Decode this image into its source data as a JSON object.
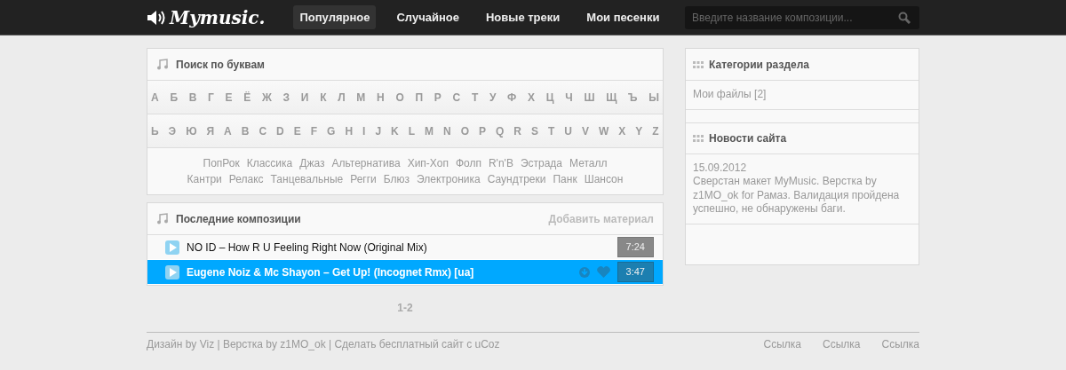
{
  "header": {
    "logo": "Mymusic.",
    "nav": [
      {
        "label": "Популярное",
        "selected": true
      },
      {
        "label": "Случайное",
        "selected": false
      },
      {
        "label": "Новые треки",
        "selected": false
      },
      {
        "label": "Мои песенки",
        "selected": false
      }
    ],
    "search": {
      "placeholder": "Введите название композиции..."
    }
  },
  "letter_search": {
    "title": "Поиск по буквам",
    "letter_rows": [
      [
        "А",
        "Б",
        "В",
        "Г",
        "Е",
        "Ё",
        "Ж",
        "З",
        "И",
        "К",
        "Л",
        "М",
        "Н",
        "О",
        "П",
        "Р",
        "С",
        "Т",
        "У",
        "Ф",
        "Х",
        "Ц",
        "Ч",
        "Ш",
        "Щ",
        "Ъ",
        "Ы"
      ],
      [
        "Ь",
        "Э",
        "Ю",
        "Я",
        "A",
        "B",
        "C",
        "D",
        "E",
        "F",
        "G",
        "H",
        "I",
        "J",
        "K",
        "L",
        "M",
        "N",
        "O",
        "P",
        "Q",
        "R",
        "S",
        "T",
        "U",
        "V",
        "W",
        "X",
        "Y",
        "Z"
      ]
    ],
    "genre_rows": [
      [
        "ПопРок",
        "Классика",
        "Джаз",
        "Альтернатива",
        "Хип-Хоп",
        "Фолп",
        "R'n'B",
        "Эстрада",
        "Металл"
      ],
      [
        "Кантри",
        "Релакс",
        "Танцевальные",
        "Регги",
        "Блюз",
        "Электроника",
        "Саундтреки",
        "Панк",
        "Шансон"
      ]
    ]
  },
  "latest": {
    "title": "Последние композиции",
    "add_link": "Добавить материал",
    "tracks": [
      {
        "title": "NO ID – How R U Feeling Right Now (Original Mix)",
        "duration": "7:24",
        "selected": false
      },
      {
        "title": "Eugene Noiz & Mc Shayon – Get Up! (Incognet Rmx) [ua]",
        "duration": "3:47",
        "selected": true
      }
    ],
    "pagination": "1-2"
  },
  "sidebar": [
    {
      "title": "Категории раздела",
      "lines": [
        "Мои файлы [2]"
      ]
    },
    {
      "title": "Новости сайта",
      "lines": [
        "15.09.2012",
        "Сверстан макет MyMusic. Верстка by z1MO_ok for Рамаз. Валидация пройдена успешно, не обнаружены баги."
      ]
    }
  ],
  "footer": {
    "credits": "Дизайн by Viz | Верстка by z1MO_ok | Сделать бесплатный сайт с uCoz",
    "links": [
      "Ссылка",
      "Ссылка",
      "Ссылка"
    ]
  }
}
